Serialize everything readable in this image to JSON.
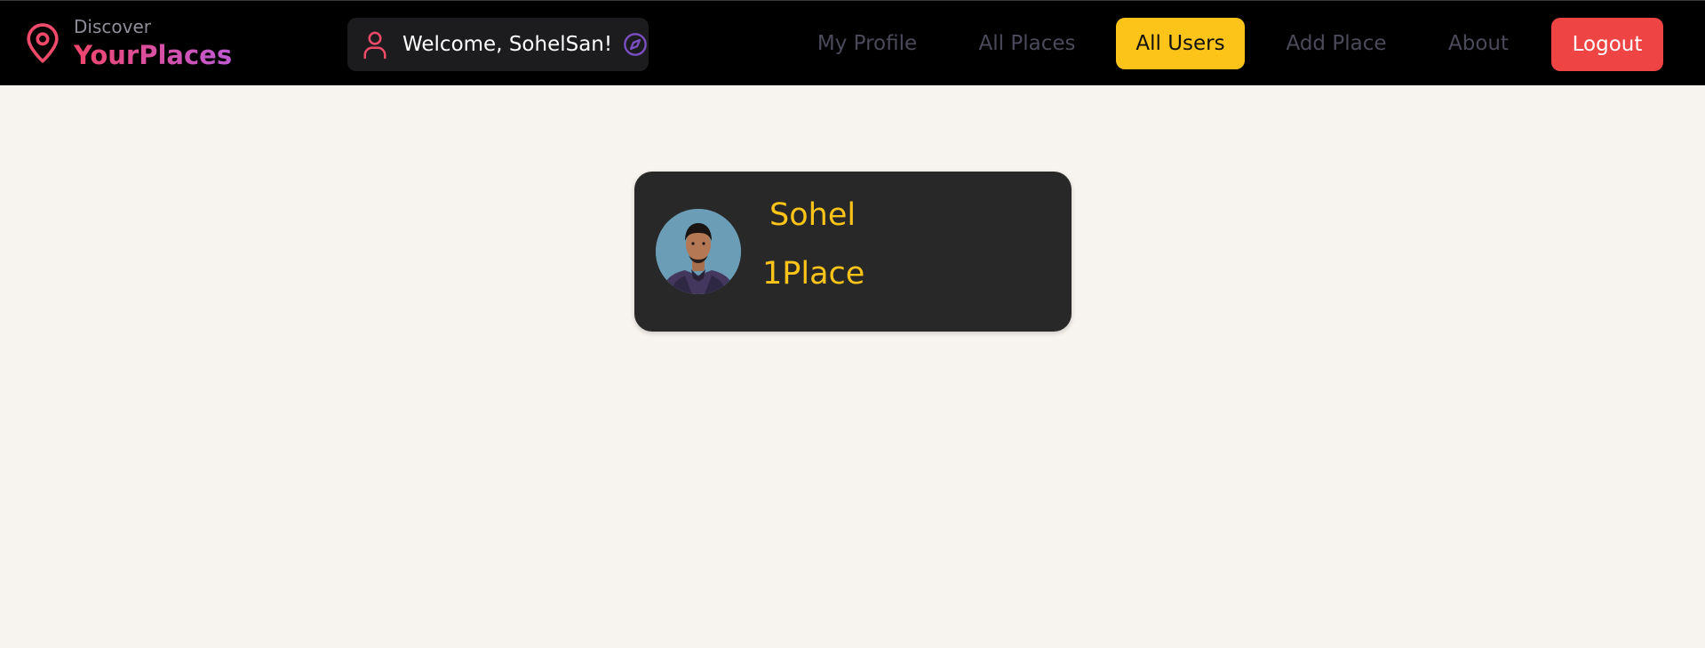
{
  "brand": {
    "small": "Discover",
    "big": "YourPlaces",
    "icon": "location-pin-icon"
  },
  "welcome": {
    "text": "Welcome, SohelSan!",
    "user_icon": "user-icon",
    "badge_icon": "compass-icon"
  },
  "nav": {
    "links": [
      {
        "label": "My Profile"
      },
      {
        "label": "All Places"
      },
      {
        "label": "All Users",
        "active": true
      },
      {
        "label": "Add Place"
      },
      {
        "label": "About"
      }
    ],
    "logout": "Logout"
  },
  "users": [
    {
      "name": "Sohel",
      "places": "1Place"
    }
  ],
  "colors": {
    "page_background": "#f7f3ee",
    "navbar": "#000000",
    "accent_yellow": "#fcc419",
    "logout_red": "#ef4444",
    "brand_gradient_start": "#f0456b",
    "brand_gradient_end": "#c05ad6",
    "card": "#282828"
  }
}
